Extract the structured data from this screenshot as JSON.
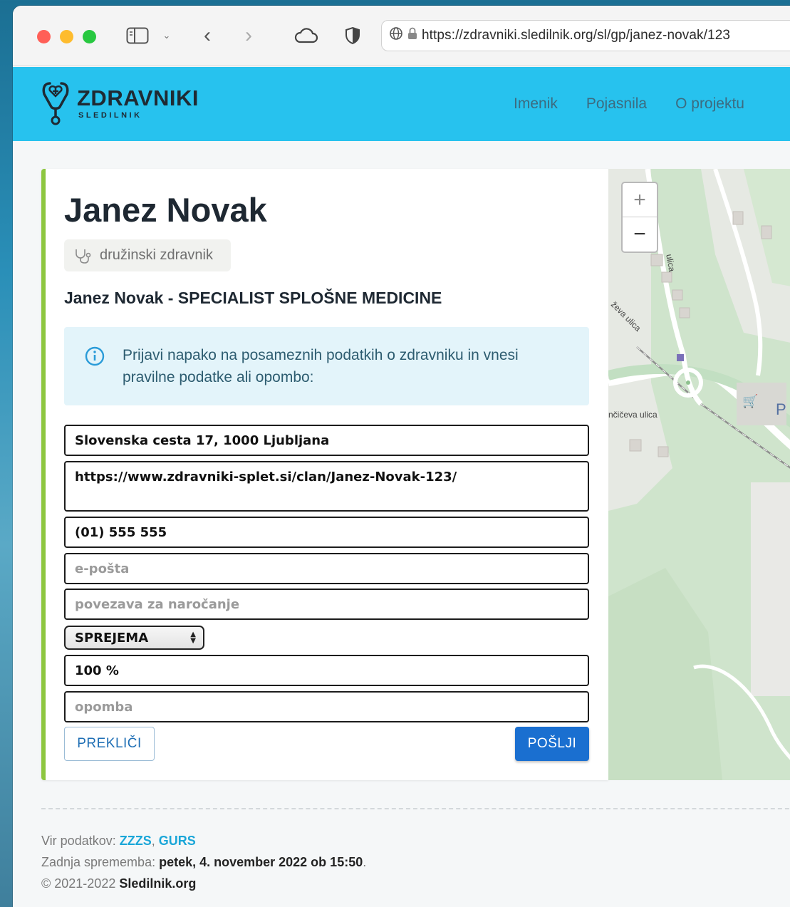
{
  "browser": {
    "url": "https://zdravniki.sledilnik.org/sl/gp/janez-novak/123"
  },
  "site": {
    "logo_title": "ZDRAVNIKI",
    "logo_subtitle": "SLEDILNIK",
    "nav": [
      "Imenik",
      "Pojasnila",
      "O projektu"
    ],
    "accent_color": "#27c2ee"
  },
  "doctor": {
    "name": "Janez Novak",
    "type_badge": "družinski zdravnik",
    "subtitle": "Janez Novak - SPECIALIST SPLOŠNE MEDICINE"
  },
  "report": {
    "info_text": "Prijavi napako na posameznih podatkih o zdravniku in vnesi pravilne podatke ali opombo:",
    "address": "Slovenska cesta 17, 1000 Ljubljana",
    "website": "https://www.zdravniki-splet.si/clan/Janez-Novak-123/",
    "phone": "(01) 555 555",
    "email_placeholder": "e-pošta",
    "booking_placeholder": "povezava za naročanje",
    "accepts_value": "SPREJEMA",
    "load_value": "100 %",
    "note_placeholder": "opomba",
    "cancel_label": "PREKLIČI",
    "send_label": "POŠLJI"
  },
  "map": {
    "zoom_in": "+",
    "zoom_out": "−",
    "street_labels": [
      "ulica",
      "ževa ulica",
      "nčičeva ulica"
    ],
    "poi_label": "P"
  },
  "footer": {
    "source_label": "Vir podatkov: ",
    "source_links": [
      "ZZZS",
      "GURS"
    ],
    "source_sep": ", ",
    "updated_label": "Zadnja sprememba: ",
    "updated_value": "petek, 4. november 2022 ob 15:50",
    "updated_end": ".",
    "copyright": "© 2021-2022 ",
    "copyright_org": "Sledilnik.org"
  }
}
